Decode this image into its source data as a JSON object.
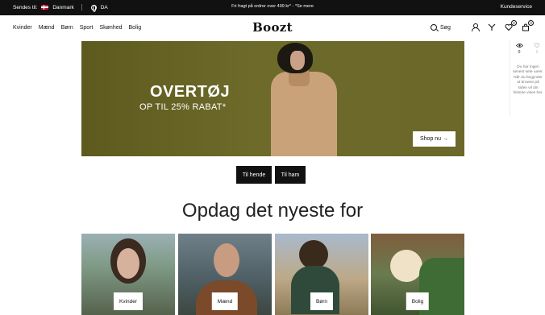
{
  "topbar": {
    "ships_to_label": "Sendes til:",
    "country": "Danmark",
    "language": "DA",
    "promo": "Fri fragt på ordrer over 499 kr* - *Se mere",
    "customer_service": "Kundeservice"
  },
  "header": {
    "nav": [
      "Kvinder",
      "Mænd",
      "Børn",
      "Sport",
      "Skønhed",
      "Bolig"
    ],
    "logo": "Boozt",
    "search_label": "Søg",
    "wishlist_count": "0",
    "cart_count": "0"
  },
  "side_widget": {
    "viewed_count": "0",
    "second_count": "0",
    "message": "Du har ingen senest sete varer. Når du begynder at browse på siden vil din historie vises her."
  },
  "hero": {
    "title": "OVERTØJ",
    "subtitle": "OP TIL 25% RABAT*",
    "cta": "Shop nu →"
  },
  "gender_buttons": [
    "Til hende",
    "Til ham"
  ],
  "discover": {
    "heading": "Opdag det nyeste for",
    "categories": [
      "Kvinder",
      "Mænd",
      "Børn",
      "Bolig"
    ]
  },
  "colors": {
    "topbar_bg": "#111111",
    "hero_bg": "#6b6829",
    "button_dark": "#111111"
  }
}
